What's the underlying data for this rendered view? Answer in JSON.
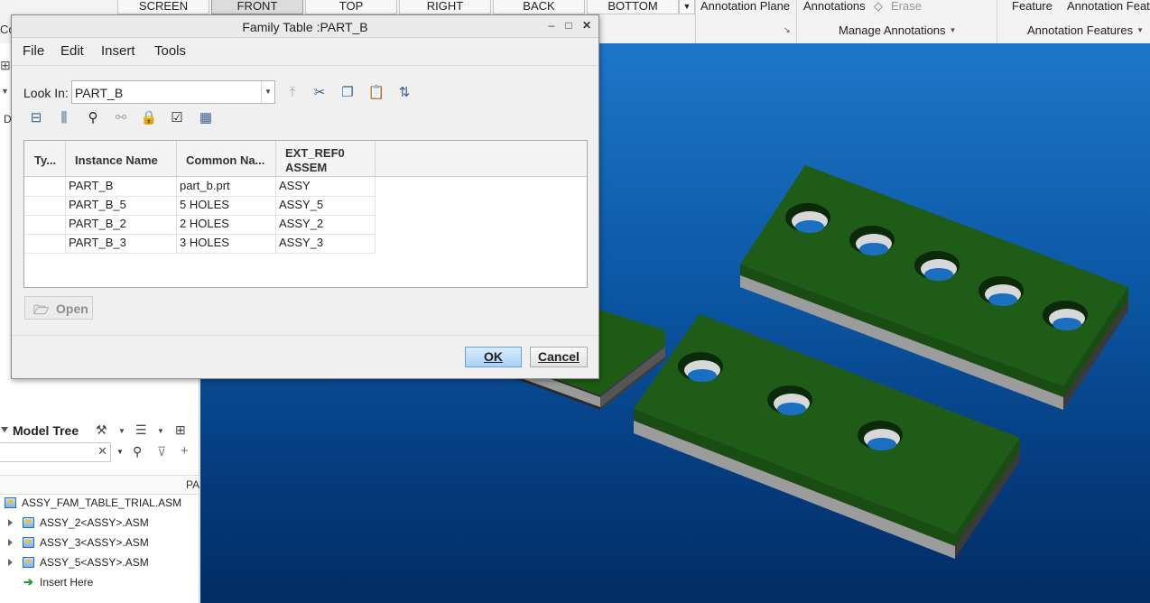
{
  "ribbon": {
    "views": [
      "SCREEN",
      "FRONT",
      "TOP",
      "RIGHT",
      "BACK",
      "BOTTOM"
    ],
    "active_view": "FRONT",
    "annotation_plane": "Annotation Plane",
    "annotations": "Annotations",
    "erase": "Erase",
    "feature": "Feature",
    "annotation_feat": "Annotation Feat",
    "manage_annotations": "Manage Annotations",
    "annotation_features": "Annotation Features",
    "left_fragment": "Co"
  },
  "left_panel": {
    "fragment_d": "D",
    "model_tree": {
      "title": "Model Tree",
      "column_fragment": "PA",
      "items": [
        {
          "label": "ASSY_FAM_TABLE_TRIAL.ASM",
          "expandable": false
        },
        {
          "label": "ASSY_2<ASSY>.ASM",
          "expandable": true
        },
        {
          "label": "ASSY_3<ASSY>.ASM",
          "expandable": true
        },
        {
          "label": "ASSY_5<ASSY>.ASM",
          "expandable": true
        }
      ],
      "insert_here": "Insert Here"
    }
  },
  "dialog": {
    "title": "Family Table :PART_B",
    "menu": [
      "File",
      "Edit",
      "Insert",
      "Tools"
    ],
    "look_in_label": "Look In:",
    "look_in_value": "PART_B",
    "table": {
      "headers": [
        "Ty...",
        "Instance Name",
        "Common Na...",
        "EXT_REF0",
        "ASSEM"
      ],
      "rows": [
        {
          "type": "",
          "instance": "PART_B",
          "common": "part_b.prt",
          "ext": "ASSY"
        },
        {
          "type": "",
          "instance": "PART_B_5",
          "common": "5 HOLES",
          "ext": "ASSY_5"
        },
        {
          "type": "",
          "instance": "PART_B_2",
          "common": "2 HOLES",
          "ext": "ASSY_2"
        },
        {
          "type": "",
          "instance": "PART_B_3",
          "common": "3 HOLES",
          "ext": "ASSY_3"
        }
      ]
    },
    "open_label": "Open",
    "ok_label": "OK",
    "cancel_label": "Cancel"
  },
  "colors": {
    "viewport_top": "#1f76c8",
    "viewport_bottom": "#022c63",
    "part_green": "#1e5c16",
    "part_edge": "#9a9a9a"
  }
}
